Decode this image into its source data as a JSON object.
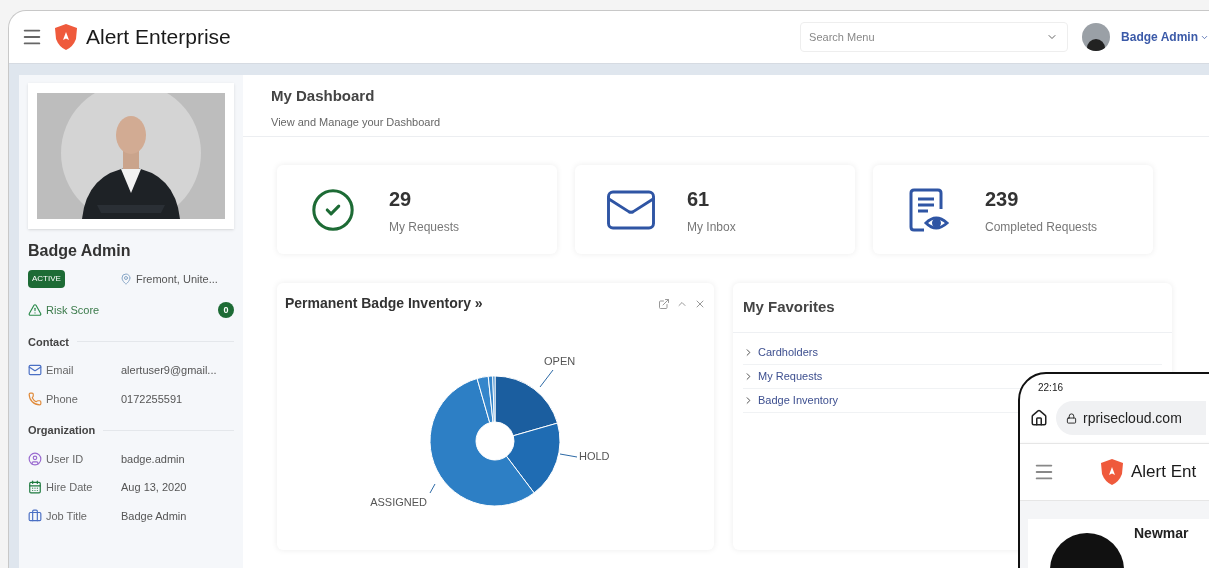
{
  "header": {
    "brand": "Alert Enterprise",
    "search": {
      "placeholder": "Search Menu"
    },
    "user": "Badge Admin"
  },
  "profile": {
    "name": "Badge Admin",
    "status": "ACTIVE",
    "location": "Fremont, Unite...",
    "risk_label": "Risk Score",
    "risk_score": "0",
    "sections": [
      {
        "title": "Contact",
        "fields": [
          {
            "kind": "email",
            "label": "Email",
            "value": "alertuser9@gmail..."
          },
          {
            "kind": "phone",
            "label": "Phone",
            "value": "0172255591"
          }
        ]
      },
      {
        "title": "Organization",
        "fields": [
          {
            "kind": "id",
            "label": "User ID",
            "value": "badge.admin"
          },
          {
            "kind": "date",
            "label": "Hire Date",
            "value": "Aug 13, 2020"
          },
          {
            "kind": "job",
            "label": "Job Title",
            "value": "Badge Admin"
          }
        ]
      }
    ]
  },
  "dashboard": {
    "title": "My Dashboard",
    "subtitle": "View and Manage your Dashboard",
    "stats": [
      {
        "kind": "check",
        "value": "29",
        "label": "My Requests"
      },
      {
        "kind": "mail",
        "value": "61",
        "label": "My Inbox"
      },
      {
        "kind": "document",
        "value": "239",
        "label": "Completed Requests"
      }
    ]
  },
  "inventory_widget": {
    "title": "Permanent Badge Inventory »",
    "slice_labels": [
      "OPEN",
      "HOLD",
      "ASSIGNED"
    ]
  },
  "favorites": {
    "title": "My Favorites",
    "items": [
      "Cardholders",
      "My Requests",
      "Badge Inventory"
    ]
  },
  "phone": {
    "time": "22:16",
    "url": "rprisecloud.com",
    "brand": "Alert Ent",
    "name": "Newmar"
  }
}
